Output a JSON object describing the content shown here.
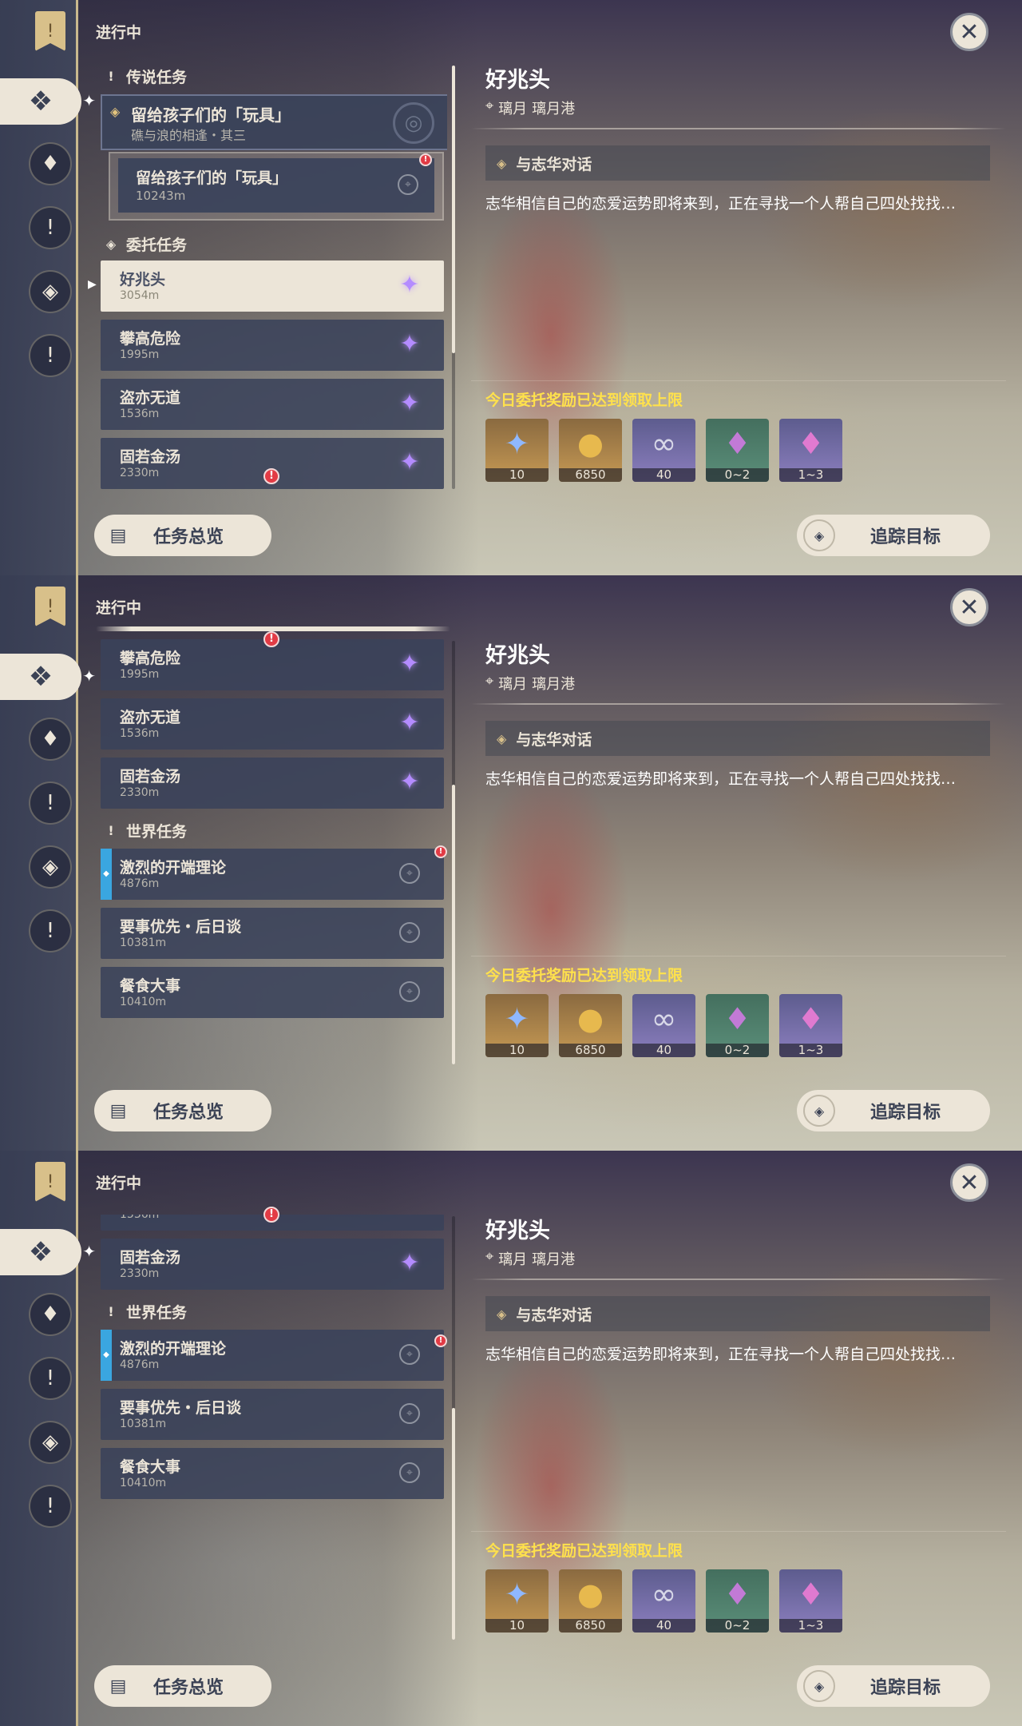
{
  "header": {
    "subtitle": "进行中",
    "close_glyph": "✕"
  },
  "sidebar_icons": [
    "quest-book-icon",
    "commission-quest-icon",
    "archon-quest-icon",
    "story-quest-icon",
    "world-quest-diamond-icon",
    "world-quest-icon"
  ],
  "sections": {
    "legend": "传说任务",
    "commission": "委托任务",
    "world": "世界任务"
  },
  "legend_quest": {
    "title": "留给孩子们的「玩具」",
    "subtitle": "礁与浪的相逢・其三"
  },
  "legend_step": {
    "title": "留给孩子们的「玩具」",
    "distance": "10243m"
  },
  "commissions": [
    {
      "title": "好兆头",
      "distance": "3054m"
    },
    {
      "title": "攀高危险",
      "distance": "1995m"
    },
    {
      "title": "盗亦无道",
      "distance": "1536m"
    },
    {
      "title": "固若金汤",
      "distance": "2330m"
    }
  ],
  "world_quests": [
    {
      "title": "激烈的开端理论",
      "distance": "4876m"
    },
    {
      "title": "要事优先・后日谈",
      "distance": "10381m"
    },
    {
      "title": "餐食大事",
      "distance": "10410m"
    }
  ],
  "detail": {
    "title": "好兆头",
    "location_region": "璃月",
    "location_area": "璃月港",
    "objective": "与志华对话",
    "description": "志华相信自己的恋爱运势即将来到，正在寻找一个人帮自己四处找找…",
    "reward_label": "今日委托奖励已达到领取上限"
  },
  "rewards": [
    {
      "icon": "adventure-exp-icon",
      "count": "10"
    },
    {
      "icon": "mora-coin-icon",
      "count": "6850"
    },
    {
      "icon": "companionship-exp-icon",
      "count": "40"
    },
    {
      "icon": "crystal-ore-icon",
      "count": "0~2"
    },
    {
      "icon": "purple-crystal-icon",
      "count": "1~3"
    }
  ],
  "buttons": {
    "overview": "任务总览",
    "track": "追踪目标"
  },
  "colors": {
    "accent_text": "#ffe14c",
    "panel_cream": "#ece5d8",
    "row_bg": "#3a425a",
    "alert_red": "#e23b45",
    "tracked_blue": "#3aa6e0"
  }
}
